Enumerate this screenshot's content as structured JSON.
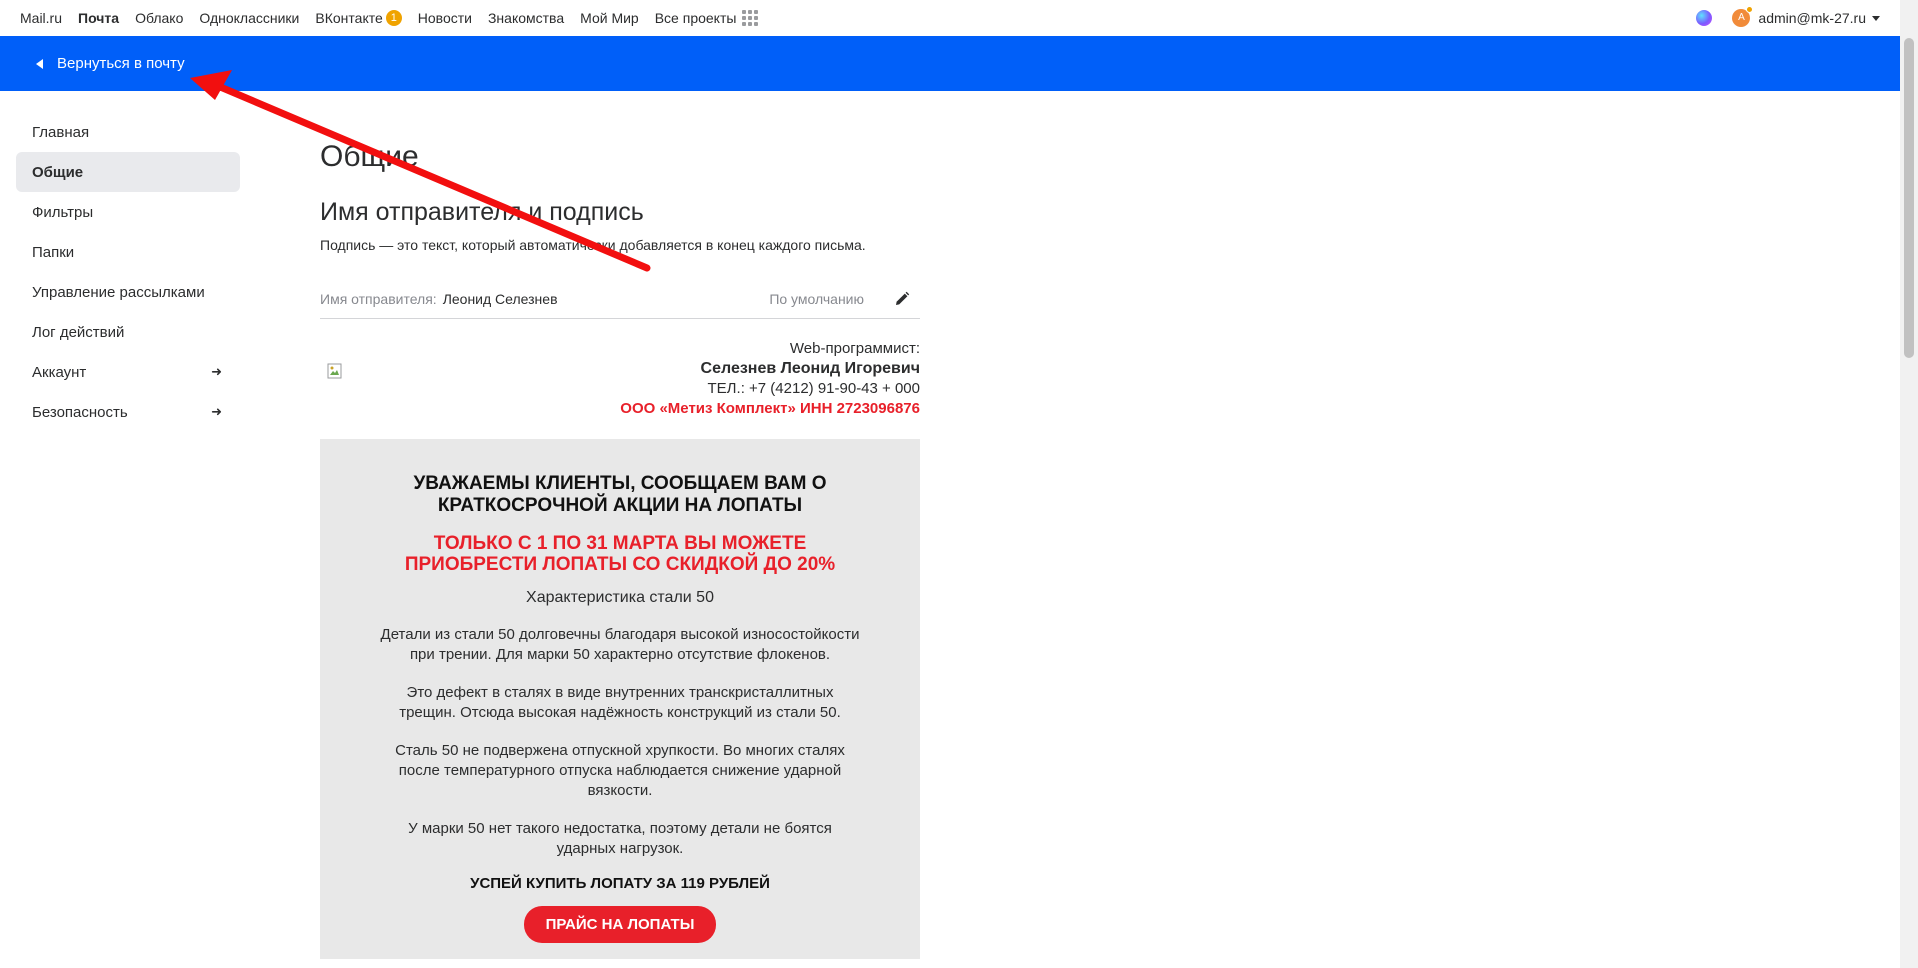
{
  "topbar": {
    "links": [
      {
        "label": "Mail.ru",
        "active": false
      },
      {
        "label": "Почта",
        "active": true
      },
      {
        "label": "Облако",
        "active": false
      },
      {
        "label": "Одноклассники",
        "active": false
      },
      {
        "label": "ВКонтакте",
        "active": false,
        "badge": "1"
      },
      {
        "label": "Новости",
        "active": false
      },
      {
        "label": "Знакомства",
        "active": false
      },
      {
        "label": "Мой Мир",
        "active": false
      },
      {
        "label": "Все проекты",
        "active": false
      }
    ],
    "user_email": "admin@mk-27.ru"
  },
  "header": {
    "back_label": "Вернуться в почту"
  },
  "sidebar": {
    "items": [
      {
        "label": "Главная",
        "active": false,
        "has_arrow": false
      },
      {
        "label": "Общие",
        "active": true,
        "has_arrow": false
      },
      {
        "label": "Фильтры",
        "active": false,
        "has_arrow": false
      },
      {
        "label": "Папки",
        "active": false,
        "has_arrow": false
      },
      {
        "label": "Управление рассылками",
        "active": false,
        "has_arrow": false
      },
      {
        "label": "Лог действий",
        "active": false,
        "has_arrow": false
      },
      {
        "label": "Аккаунт",
        "active": false,
        "has_arrow": true
      },
      {
        "label": "Безопасность",
        "active": false,
        "has_arrow": true
      }
    ]
  },
  "main": {
    "page_title": "Общие",
    "section_title": "Имя отправителя и подпись",
    "section_desc": "Подпись — это текст, который автоматически добавляется в конец каждого письма.",
    "sender_label": "Имя отправителя:",
    "sender_value": "Леонид Селезнев",
    "default_label": "По умолчанию",
    "signature": {
      "line1": "Web-программист:",
      "line2": "Селезнев Леонид Игоревич",
      "line3": "ТЕЛ.: +7 (4212) 91-90-43 + 000",
      "line4": "ООО «Метиз Комплект» ИНН 2723096876"
    },
    "promo": {
      "title": "УВАЖАЕМЫ КЛИЕНТЫ, СООБЩАЕМ ВАМ О КРАТКОСРОЧНОЙ АКЦИИ НА ЛОПАТЫ",
      "red": "ТОЛЬКО С 1 ПО 31 МАРТА ВЫ МОЖЕТЕ ПРИОБРЕСТИ ЛОПАТЫ СО СКИДКОЙ ДО 20%",
      "subtitle": "Характеристика стали 50",
      "para1": "Детали из стали 50 долговечны благодаря высокой износостойкости при трении. Для марки 50 характерно отсутствие флокенов.",
      "para2": "Это дефект в сталях в виде внутренних транскристаллитных трещин. Отсюда высокая надёжность конструкций из стали 50.",
      "para3": "Сталь 50 не подвержена отпускной хрупкости. Во многих сталях после температурного отпуска наблюдается снижение ударной вязкости.",
      "para4": "У марки 50 нет такого недостатка, поэтому детали не боятся ударных нагрузок.",
      "cta": "УСПЕЙ КУПИТЬ ЛОПАТУ ЗА 119 РУБЛЕЙ",
      "button": "ПРАЙС НА ЛОПАТЫ"
    }
  },
  "colors": {
    "header_blue": "#005ff9",
    "accent_red": "#e8202a",
    "annotation_arrow": "#f20f0f"
  }
}
